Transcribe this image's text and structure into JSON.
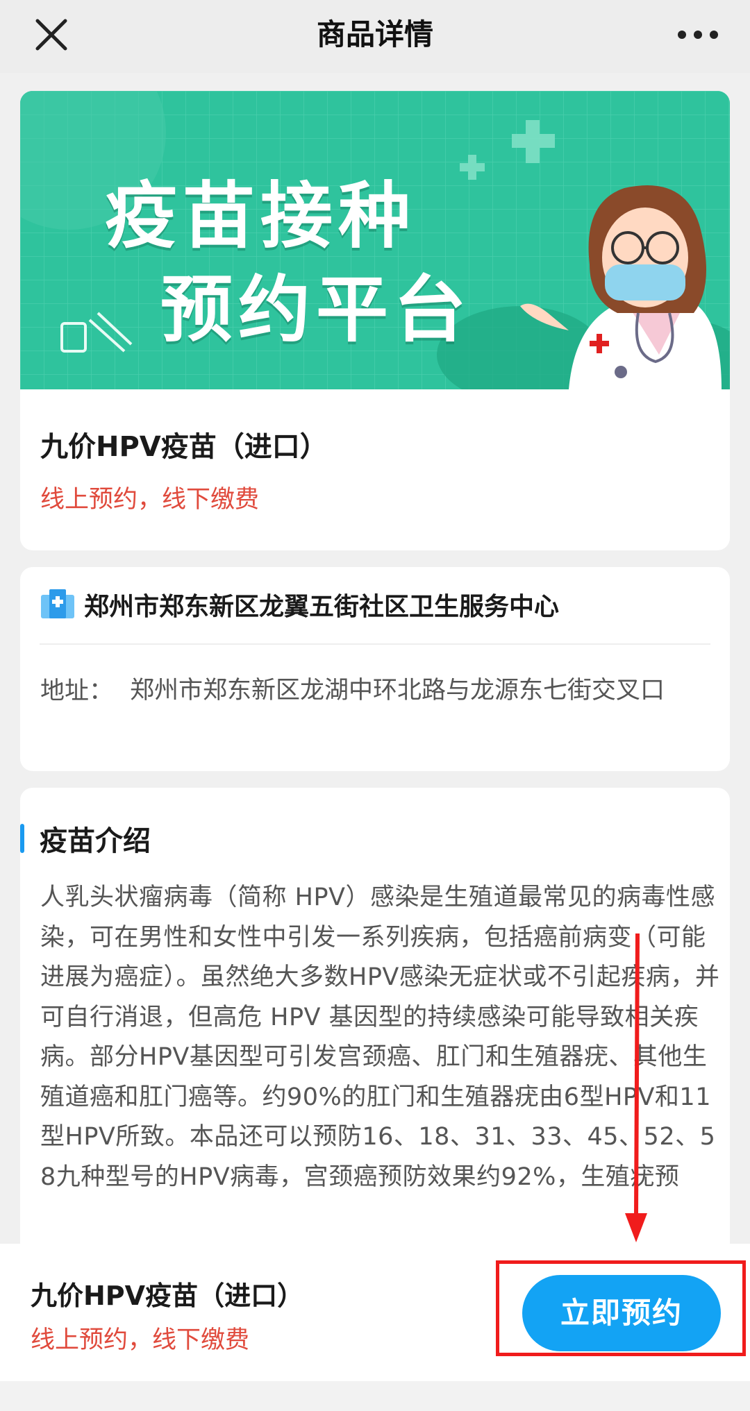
{
  "header": {
    "title": "商品详情",
    "close_icon": "close-icon",
    "more_icon": "more-dots-icon"
  },
  "banner": {
    "line1": "疫苗接种",
    "line2": "预约平台",
    "background": "#2fc39d"
  },
  "product": {
    "name": "九价HPV疫苗（进口）",
    "note": "线上预约，线下缴费"
  },
  "clinic": {
    "icon": "hospital-icon",
    "name": "郑州市郑东新区龙翼五街社区卫生服务中心",
    "address_label": "地址：",
    "address_value": "郑州市郑东新区龙湖中环北路与龙源东七街交叉口"
  },
  "intro": {
    "title": "疫苗介绍",
    "text": "人乳头状瘤病毒（简称 HPV）感染是生殖道最常见的病毒性感染，可在男性和女性中引发一系列疾病，包括癌前病变（可能进展为癌症）。虽然绝大多数HPV感染无症状或不引起疾病，并可自行消退，但高危 HPV 基因型的持续感染可能导致相关疾病。部分HPV基因型可引发宫颈癌、肛门和生殖器疣、其他生殖道癌和肛门癌等。约90%的肛门和生殖器疣由6型HPV和11型HPV所致。本品还可以预防16、18、31、33、45、52、58九种型号的HPV病毒，宫颈癌预防效果约92%，生殖疣预"
  },
  "bottom_bar": {
    "name": "九价HPV疫苗（进口）",
    "note": "线上预约，线下缴费",
    "button_label": "立即预约"
  },
  "colors": {
    "accent": "#13a3f4",
    "warning_text": "#e04a3c",
    "annotation": "#f01c1c"
  }
}
